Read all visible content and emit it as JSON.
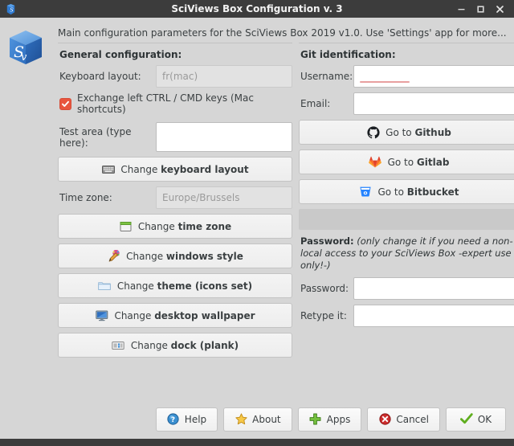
{
  "window": {
    "title": "SciViews Box Configuration v. 3",
    "app_icon": "sciviews-cube-icon",
    "controls": [
      {
        "name": "minimize",
        "glyph": "minimize-icon"
      },
      {
        "name": "maximize",
        "glyph": "maximize-icon"
      },
      {
        "name": "close",
        "glyph": "close-icon"
      }
    ]
  },
  "header": {
    "subtitle": "Main configuration parameters for the SciViews Box 2019 v1.0. Use 'Settings' app for more..."
  },
  "left": {
    "section_title": "General configuration:",
    "keyboard_label": "Keyboard layout:",
    "keyboard_value": "fr(mac)",
    "exchange_checkbox_label": "Exchange left CTRL / CMD keys (Mac shortcuts)",
    "exchange_checked": true,
    "testarea_label": "Test area (type here):",
    "testarea_value": "",
    "btn_keyboard_prefix": "Change ",
    "btn_keyboard_bold": "keyboard layout",
    "timezone_label": "Time zone:",
    "timezone_value": "Europe/Brussels",
    "btn_timezone_prefix": "Change ",
    "btn_timezone_bold": "time zone",
    "btn_winstyle_prefix": "Change ",
    "btn_winstyle_bold": "windows style",
    "btn_theme_prefix": "Change ",
    "btn_theme_bold": "theme (icons set)",
    "btn_wallpaper_prefix": "Change ",
    "btn_wallpaper_bold": "desktop wallpaper",
    "btn_dock_prefix": "Change ",
    "btn_dock_bold": "dock (plank)"
  },
  "right": {
    "section_title": "Git identification:",
    "username_label": "Username:",
    "username_value": "",
    "email_label": "Email:",
    "email_value": "",
    "btn_github_prefix": "Go to ",
    "btn_github_bold": "Github",
    "btn_gitlab_prefix": "Go to ",
    "btn_gitlab_bold": "Gitlab",
    "btn_bitbucket_prefix": "Go to ",
    "btn_bitbucket_bold": "Bitbucket",
    "password_note_bold": "Password:",
    "password_note_text": " (only change it if you need a non-local access to your SciViews Box -expert use only!-)",
    "password_label": "Password:",
    "password_value": "",
    "retype_label": "Retype it:",
    "retype_value": ""
  },
  "footer": {
    "help": "Help",
    "about": "About",
    "apps": "Apps",
    "cancel": "Cancel",
    "ok": "OK"
  },
  "colors": {
    "titlebar": "#3c3c3c",
    "background": "#d6d6d6",
    "checkbox_red": "#e8553e",
    "gitlab_orange": "#e2432a",
    "bitbucket_blue": "#2684ff",
    "help_blue": "#3a8fd0",
    "about_orange": "#f0b429",
    "apps_green": "#66b032",
    "cancel_red": "#cc2222",
    "ok_green": "#55a516",
    "spellcheck_red": "#e8a0a0"
  }
}
